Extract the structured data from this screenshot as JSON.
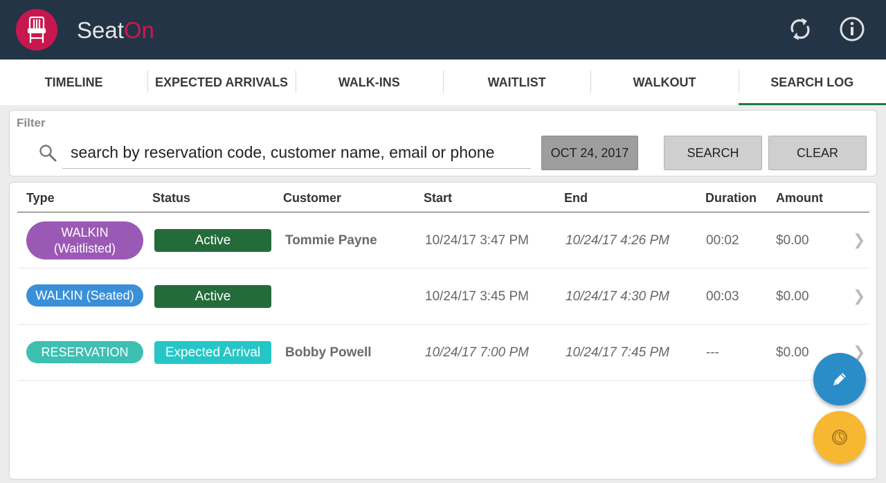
{
  "app": {
    "brand_part1": "Seat",
    "brand_part2": "On",
    "logo_icon": "chair-icon",
    "header_icons": [
      "sync-icon",
      "info-icon"
    ]
  },
  "tabs": [
    {
      "label": "TIMELINE",
      "active": false
    },
    {
      "label": "EXPECTED ARRIVALS",
      "active": false
    },
    {
      "label": "WALK-INS",
      "active": false
    },
    {
      "label": "WAITLIST",
      "active": false
    },
    {
      "label": "WALKOUT",
      "active": false
    },
    {
      "label": "SEARCH LOG",
      "active": true
    }
  ],
  "filter": {
    "label": "Filter",
    "search_placeholder": "search by reservation code, customer name, email or phone",
    "date_label": "OCT 24, 2017",
    "search_button": "SEARCH",
    "clear_button": "CLEAR"
  },
  "table": {
    "columns": [
      "Type",
      "Status",
      "Customer",
      "Start",
      "End",
      "Duration",
      "Amount"
    ],
    "rows": [
      {
        "type_line1": "WALKIN",
        "type_line2": "(Waitlisted)",
        "type_color": "#9b59b6",
        "status": "Active",
        "status_color": "#246b3a",
        "customer": "Tommie Payne",
        "start": "10/24/17 3:47 PM",
        "end": "10/24/17 4:26 PM",
        "duration": "00:02",
        "amount": "$0.00"
      },
      {
        "type_line1": "WALKIN (Seated)",
        "type_line2": "",
        "type_color": "#3a8fd9",
        "status": "Active",
        "status_color": "#246b3a",
        "customer": "",
        "start": "10/24/17 3:45 PM",
        "end": "10/24/17 4:30 PM",
        "duration": "00:03",
        "amount": "$0.00"
      },
      {
        "type_line1": "RESERVATION",
        "type_line2": "",
        "type_color": "#3dbfb1",
        "status": "Expected Arrival",
        "status_color": "#26c6c6",
        "customer": "Bobby Powell",
        "start": "10/24/17 7:00 PM",
        "end": "10/24/17 7:45 PM",
        "duration": "---",
        "amount": "$0.00"
      }
    ]
  },
  "fabs": {
    "edit_icon": "pencil-icon",
    "edit_color": "#2a8dc8",
    "history_icon": "clock-icon",
    "history_color": "#f7b731"
  },
  "colors": {
    "header_bg": "#243447",
    "brand_accent": "#d0164f",
    "active_tab_underline": "#1f7a44"
  }
}
